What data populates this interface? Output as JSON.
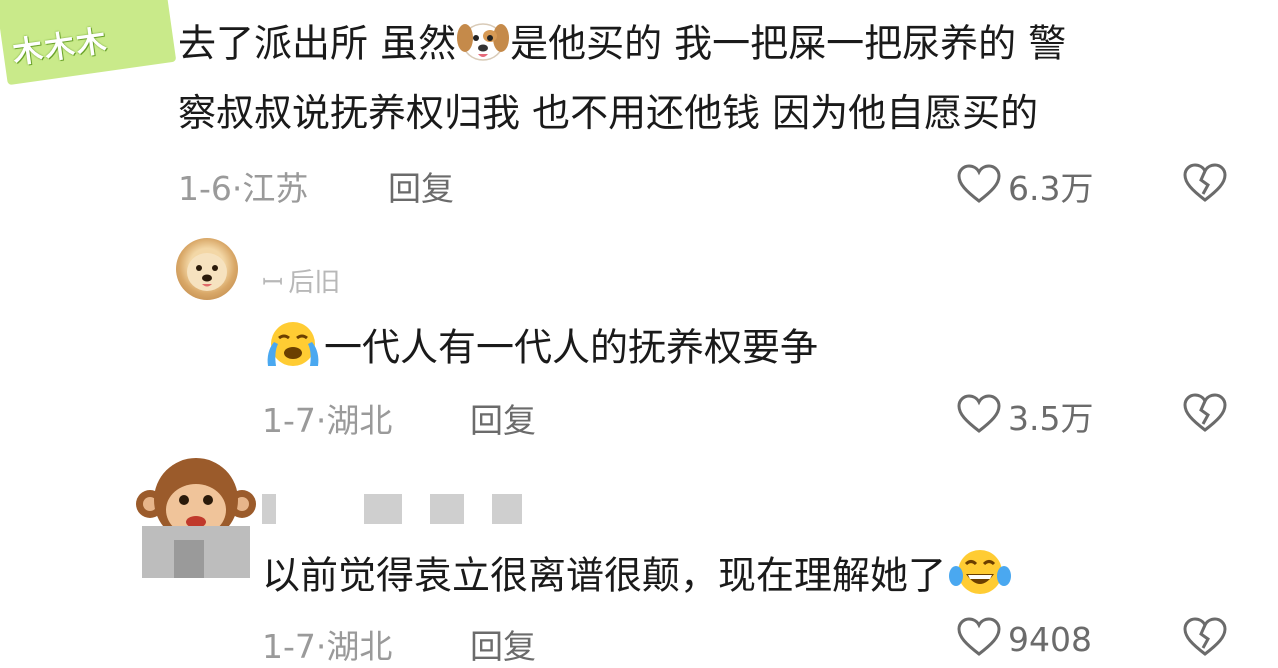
{
  "comments": [
    {
      "text_line1_a": "去了派出所 虽然",
      "text_line1_b": "是他买的 我一把屎一把尿养的 警",
      "text_line2": "察叔叔说抚养权归我 也不用还他钱 因为他自愿买的",
      "date": "1-6·",
      "location": "江苏",
      "reply_label": "回复",
      "likes": "6.3万",
      "emoji_inline": "dog-face",
      "sticker_text": "木木木"
    },
    {
      "username": "ꟷ 后旧",
      "text": "一代人有一代人的抚养权要争",
      "date": "1-7·",
      "location": "湖北",
      "reply_label": "回复",
      "likes": "3.5万",
      "emoji_inline": "loudly-crying-face"
    },
    {
      "text": "以前觉得袁立很离谱很颠，现在理解她了",
      "date": "1-7·",
      "location": "湖北",
      "reply_label": "回复",
      "likes": "9408",
      "emoji_inline": "tears-of-joy-face"
    }
  ],
  "colors": {
    "text": "#1a1a1a",
    "meta": "#9a9a9a",
    "sticker": "#c9ea8a"
  }
}
